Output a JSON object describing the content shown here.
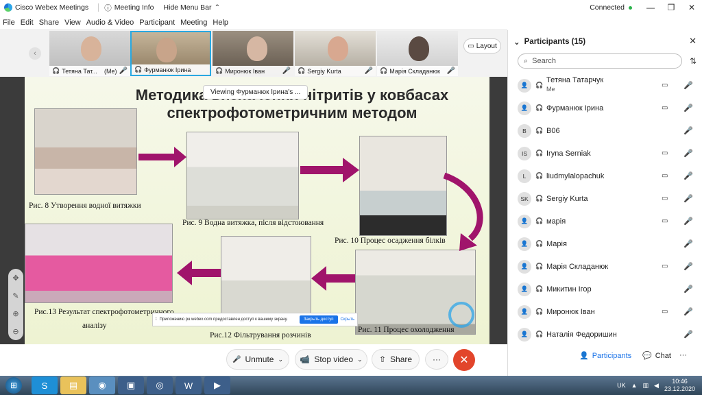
{
  "titlebar": {
    "app_name": "Cisco Webex Meetings",
    "meeting_info": "Meeting Info",
    "hide_menu_bar": "Hide Menu Bar",
    "status": "Connected"
  },
  "menu": [
    "File",
    "Edit",
    "Share",
    "View",
    "Audio & Video",
    "Participant",
    "Meeting",
    "Help"
  ],
  "filmstrip": {
    "thumbs": [
      {
        "name": "Тетяна Тат...",
        "me": "(Me)"
      },
      {
        "name": "Фурманюк Ірина",
        "me": ""
      },
      {
        "name": "Миронюк Іван",
        "me": ""
      },
      {
        "name": "Sergiy Kurta",
        "me": ""
      },
      {
        "name": "Марія Складанюк",
        "me": ""
      }
    ],
    "layout_label": "Layout"
  },
  "stage": {
    "viewing_label": "Viewing Фурманюк Ірина's ...",
    "slide": {
      "title_line1": "Методика визначення нітритів у ковбасах",
      "title_line2": "спектрофотометричним методом",
      "captions": [
        "Рис. 8 Утворення водної витяжки",
        "Рис. 9 Водна витяжка, після відстоювання",
        "Рис. 10 Процес осадження білків",
        "Рис. 11 Процес охолодження",
        "Рис.12 Фільтрування розчинів",
        "Рис.13 Результат спектрофотометричного",
        "аналізу"
      ]
    },
    "share_banner": {
      "text": "Приложению pu.webex.com предоставлен доступ к вашему экрану.",
      "close_access": "Закрыть доступ",
      "hide": "Скрыть"
    }
  },
  "controls": {
    "unmute": "Unmute",
    "stop_video": "Stop video",
    "share": "Share",
    "more": "···",
    "end": "✕"
  },
  "panel": {
    "title": "Participants (15)",
    "search_placeholder": "Search",
    "participants": [
      {
        "initials": "",
        "name": "Тетяна Татарчук",
        "sub": "Me",
        "cam": true,
        "mic": "muted"
      },
      {
        "initials": "",
        "name": "Фурманюк Ірина",
        "sub": "",
        "cam": true,
        "mic": "active"
      },
      {
        "initials": "B",
        "name": "B06",
        "sub": "",
        "cam": false,
        "mic": "muted"
      },
      {
        "initials": "IS",
        "name": "Iryna Serniak",
        "sub": "",
        "cam": true,
        "mic": "muted"
      },
      {
        "initials": "L",
        "name": "liudmylalopachuk",
        "sub": "",
        "cam": true,
        "mic": "muted"
      },
      {
        "initials": "SK",
        "name": "Sergiy Kurta",
        "sub": "",
        "cam": true,
        "mic": "muted"
      },
      {
        "initials": "",
        "name": "марія",
        "sub": "",
        "cam": true,
        "mic": "muted"
      },
      {
        "initials": "",
        "name": "Марія",
        "sub": "",
        "cam": false,
        "mic": "muted"
      },
      {
        "initials": "",
        "name": "Марія Складанюк",
        "sub": "",
        "cam": true,
        "mic": "muted"
      },
      {
        "initials": "",
        "name": "Микитин Ігор",
        "sub": "",
        "cam": false,
        "mic": "muted"
      },
      {
        "initials": "",
        "name": "Миронюк Іван",
        "sub": "",
        "cam": true,
        "mic": "muted"
      },
      {
        "initials": "",
        "name": "Наталія Федоришин",
        "sub": "",
        "cam": false,
        "mic": "muted"
      }
    ],
    "tab_participants": "Participants",
    "tab_chat": "Chat",
    "tab_more": "···"
  },
  "taskbar": {
    "lang": "UK",
    "time": "10:46",
    "date": "23.12.2020"
  },
  "colors": {
    "accent": "#29a8e0",
    "arrow": "#a0146b",
    "end": "#e2452b",
    "muted": "#d33333",
    "active_mic": "#2bb24c"
  }
}
